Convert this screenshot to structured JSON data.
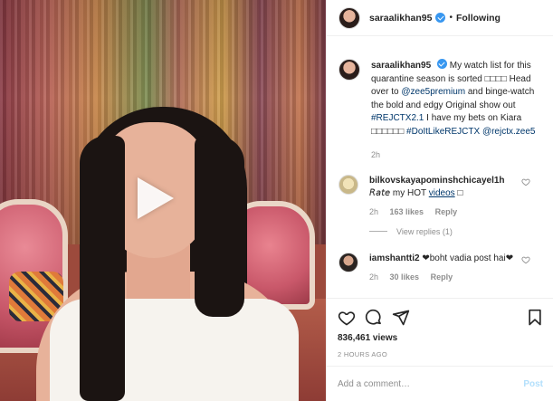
{
  "header": {
    "username": "saraalikhan95",
    "separator": "•",
    "follow_status": "Following"
  },
  "caption": {
    "username": "saraalikhan95",
    "text_1": "My watch list for this quarantine season is sorted",
    "mojibake_1": "□□□□",
    "text_2": "Head over to",
    "mention_1": "@zee5premium",
    "text_3": "and binge-watch the bold and edgy Original show out",
    "hashtag_1": "#REJCTX2.1",
    "text_4": "I have my bets on Kiara",
    "mojibake_2": "□□□□□□",
    "hashtag_2": "#DoItLikeREJCTX",
    "mention_2": "@rejctx.zee5",
    "time": "2h"
  },
  "comments": [
    {
      "username": "bilkovskayapominshchicayel1h",
      "text": "𝘙𝘢𝘵𝘦 my HOT ",
      "link": "videos",
      "tail": " □",
      "time": "2h",
      "likes": "163 likes",
      "reply": "Reply",
      "view_replies": "View replies (1)"
    },
    {
      "username": "iamshantti2",
      "text": "❤boht vadia post hai❤",
      "time": "2h",
      "likes": "30 likes",
      "reply": "Reply"
    }
  ],
  "stats": {
    "views": "836,461 views",
    "posted": "2 HOURS AGO"
  },
  "add_comment": {
    "placeholder": "Add a comment…",
    "post_label": "Post"
  },
  "colors": {
    "verified": "#3897f0",
    "link": "#00376b",
    "muted": "#8e8e8e",
    "post_disabled": "#b2dffc"
  }
}
